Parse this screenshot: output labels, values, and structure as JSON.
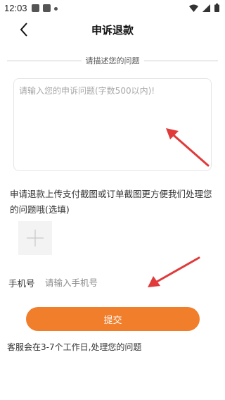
{
  "status_bar": {
    "time": "12:03",
    "icons": [
      "gallery-icon",
      "notification-icon",
      "dot-icon"
    ],
    "right_icons": [
      "wifi-icon",
      "signal-icon",
      "battery-icon"
    ]
  },
  "header": {
    "title": "申诉退款",
    "back_icon": "chevron-left-icon"
  },
  "form": {
    "section_title": "请描述您的问题",
    "description_placeholder": "请输入您的申诉问题(字数500以内)!",
    "description_value": "",
    "upload_hint": "申请退款上传支付截图或订单截图更方便我们处理您的问题哦(选填)",
    "upload_icon": "plus-icon",
    "phone_label": "手机号",
    "phone_placeholder": "请输入手机号",
    "phone_value": "",
    "submit_label": "提交",
    "service_note": "客服会在3-7个工作日,处理您的问题"
  },
  "colors": {
    "accent": "#f07e2b",
    "annotation_arrow": "#e03a3a"
  }
}
